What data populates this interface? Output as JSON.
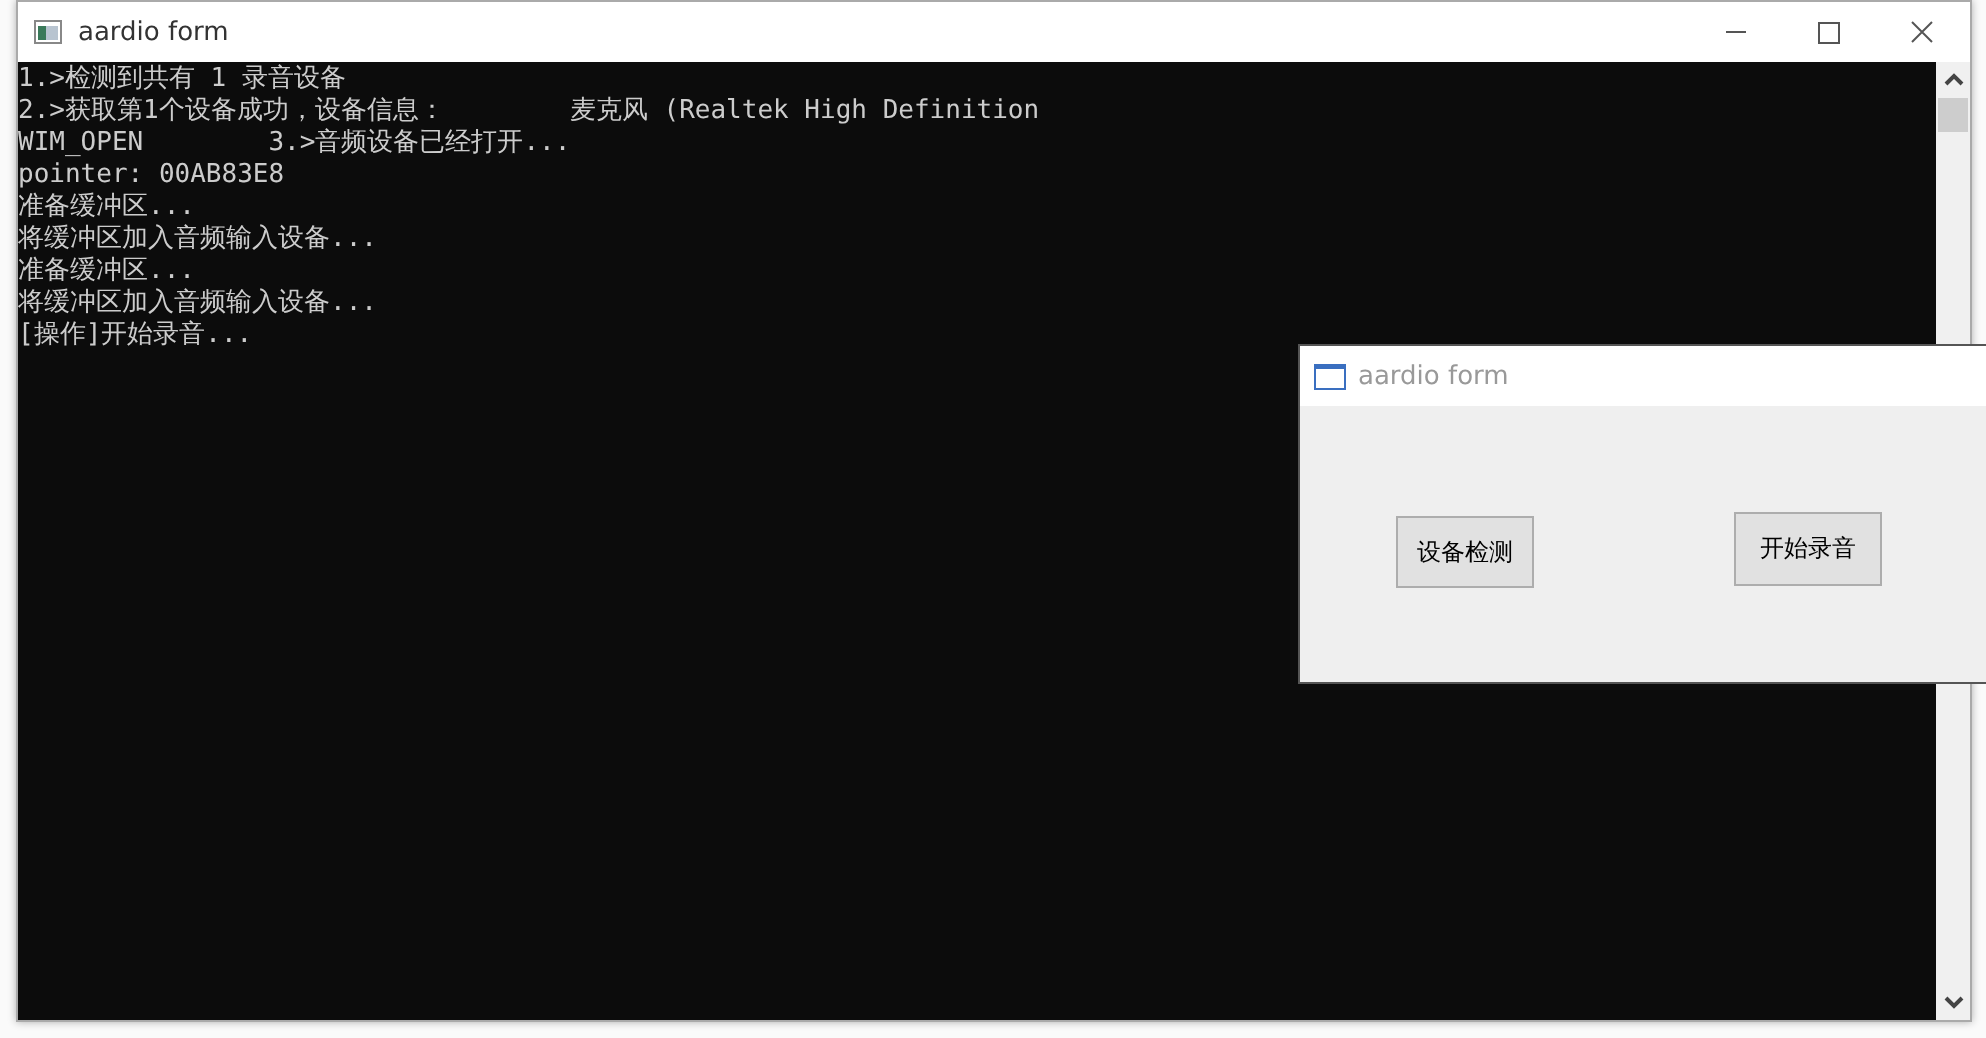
{
  "console_window": {
    "title": "aardio form",
    "lines": [
      "1.>检测到共有 1 录音设备",
      "2.>获取第1个设备成功，设备信息：        麦克风 (Realtek High Definition",
      "WIM_OPEN        3.>音频设备已经打开...",
      "pointer: 00AB83E8",
      "准备缓冲区...",
      "将缓冲区加入音频输入设备...",
      "准备缓冲区...",
      "将缓冲区加入音频输入设备...",
      "[操作]开始录音..."
    ]
  },
  "form_window": {
    "title": "aardio form",
    "buttons": [
      "设备检测",
      "开始录音"
    ]
  }
}
